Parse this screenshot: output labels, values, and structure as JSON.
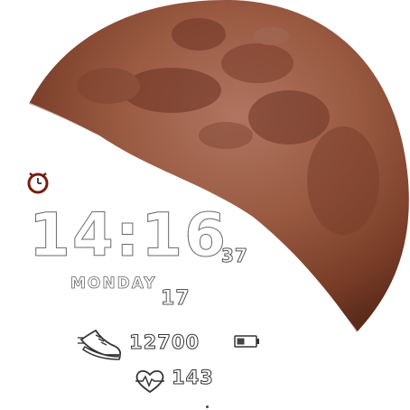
{
  "watchface": {
    "time": "14:16",
    "seconds": "37",
    "weekday": "MONDAY",
    "day": "17",
    "steps": "12700",
    "heart_rate": "143"
  },
  "icons": {
    "alarm": "alarm-clock-icon",
    "steps": "running-shoe-icon",
    "battery": "battery-icon",
    "heart_rate": "heart-rate-icon"
  },
  "colors": {
    "moon": "#8b4a32",
    "moon_shadow": "#5c2c1c",
    "alarm_ring": "#7a1c10",
    "text_outline": "#6a6a6a",
    "background": "#ffffff"
  }
}
